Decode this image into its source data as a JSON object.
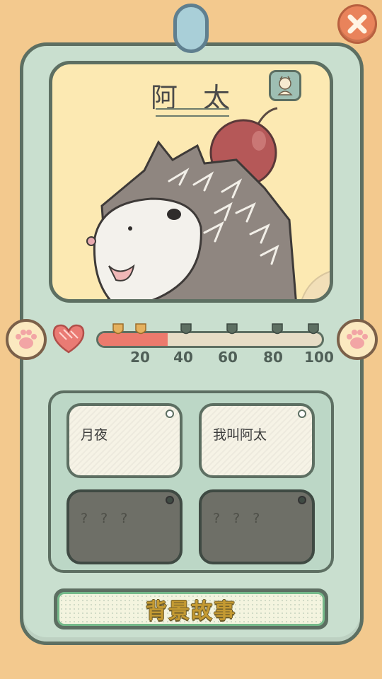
{
  "header": {
    "close_icon": "close-x-icon"
  },
  "character": {
    "name": "阿 太",
    "profile_icon": "character-avatar-icon",
    "portrait": "hedgehog-with-cherry"
  },
  "affection": {
    "heart_icon": "heart-icon",
    "left_icon": "paw-icon",
    "right_icon": "paw-icon",
    "progress": 0.31,
    "tick_labels": [
      "20",
      "40",
      "60",
      "80",
      "100"
    ],
    "milestones_unlocked": 2,
    "colors": {
      "fill": "#ec7a6d",
      "marker_on": "#e5b15e",
      "marker_off": "#5d6f62"
    }
  },
  "stories": [
    {
      "label": "月夜",
      "locked": false
    },
    {
      "label": "我叫阿太",
      "locked": false
    },
    {
      "label": "? ? ?",
      "locked": true
    },
    {
      "label": "? ? ?",
      "locked": true
    }
  ],
  "footer": {
    "background_story_label": "背景故事"
  }
}
